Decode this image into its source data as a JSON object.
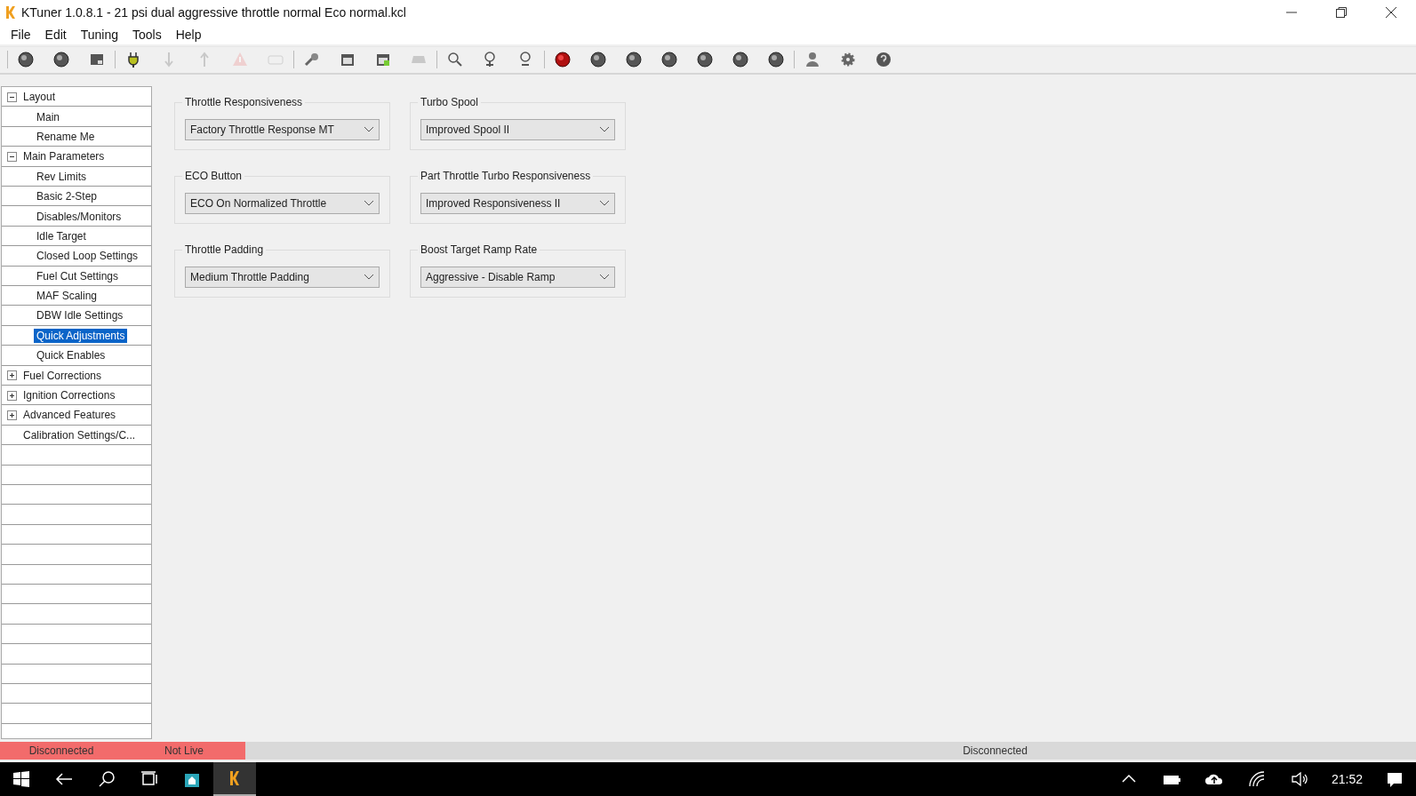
{
  "window": {
    "title": "KTuner 1.0.8.1 - 21 psi dual aggressive throttle normal Eco normal.kcl"
  },
  "menu": [
    "File",
    "Edit",
    "Tuning",
    "Tools",
    "Help"
  ],
  "toolbar": [
    [
      {
        "kind": "ball",
        "disabled": false
      },
      {
        "kind": "ball",
        "disabled": false
      },
      {
        "kind": "box",
        "disabled": false
      }
    ],
    [
      {
        "kind": "plug",
        "disabled": false
      },
      {
        "kind": "down",
        "disabled": true
      },
      {
        "kind": "up",
        "disabled": true
      },
      {
        "kind": "warning",
        "disabled": true
      },
      {
        "kind": "chip",
        "disabled": true
      }
    ],
    [
      {
        "kind": "wrench",
        "disabled": false
      },
      {
        "kind": "calendar",
        "disabled": false
      },
      {
        "kind": "calendar-green",
        "disabled": false
      },
      {
        "kind": "tray",
        "disabled": true
      }
    ],
    [
      {
        "kind": "search",
        "disabled": false
      },
      {
        "kind": "zoom-in",
        "disabled": false
      },
      {
        "kind": "zoom-out",
        "disabled": false
      }
    ],
    [
      {
        "kind": "record",
        "disabled": false
      },
      {
        "kind": "ball",
        "disabled": false
      },
      {
        "kind": "ball",
        "disabled": false
      },
      {
        "kind": "ball",
        "disabled": false
      },
      {
        "kind": "ball",
        "disabled": false
      },
      {
        "kind": "ball",
        "disabled": false
      },
      {
        "kind": "ball",
        "disabled": false
      }
    ],
    [
      {
        "kind": "person",
        "disabled": false
      },
      {
        "kind": "gear",
        "disabled": false
      },
      {
        "kind": "help",
        "disabled": false
      }
    ]
  ],
  "tree": [
    {
      "label": "Layout",
      "expanded": true,
      "selected": false,
      "children": [
        {
          "label": "Main",
          "selected": false
        },
        {
          "label": "Rename Me",
          "selected": false
        }
      ]
    },
    {
      "label": "Main Parameters",
      "expanded": true,
      "selected": false,
      "children": [
        {
          "label": "Rev Limits",
          "selected": false
        },
        {
          "label": "Basic 2-Step",
          "selected": false
        },
        {
          "label": "Disables/Monitors",
          "selected": false
        },
        {
          "label": "Idle Target",
          "selected": false
        },
        {
          "label": "Closed Loop Settings",
          "selected": false
        },
        {
          "label": "Fuel Cut Settings",
          "selected": false
        },
        {
          "label": "MAF Scaling",
          "selected": false
        },
        {
          "label": "DBW Idle Settings",
          "selected": false
        },
        {
          "label": "Quick Adjustments",
          "selected": true
        },
        {
          "label": "Quick Enables",
          "selected": false
        }
      ]
    },
    {
      "label": "Fuel Corrections",
      "expanded": false,
      "selected": false
    },
    {
      "label": "Ignition Corrections",
      "expanded": false,
      "selected": false
    },
    {
      "label": "Advanced Features",
      "expanded": false,
      "selected": false
    },
    {
      "label": "Calibration Settings/C...",
      "selected": false
    }
  ],
  "settings": [
    {
      "label": "Throttle Responsiveness",
      "value": "Factory Throttle Response MT"
    },
    {
      "label": "Turbo Spool",
      "value": "Improved Spool II"
    },
    {
      "label": "ECO Button",
      "value": "ECO On Normalized Throttle"
    },
    {
      "label": "Part Throttle Turbo Responsiveness",
      "value": "Improved Responsiveness II"
    },
    {
      "label": "Throttle Padding",
      "value": "Medium Throttle Padding"
    },
    {
      "label": "Boost Target Ramp Rate",
      "value": "Aggressive - Disable Ramp"
    }
  ],
  "status_bar": [
    {
      "text": "Disconnected",
      "color": "#f26b6b"
    },
    {
      "text": "Not Live",
      "color": "#f26b6b"
    },
    {
      "text": "Disconnected"
    }
  ],
  "taskbar": {
    "time": "21:52"
  }
}
